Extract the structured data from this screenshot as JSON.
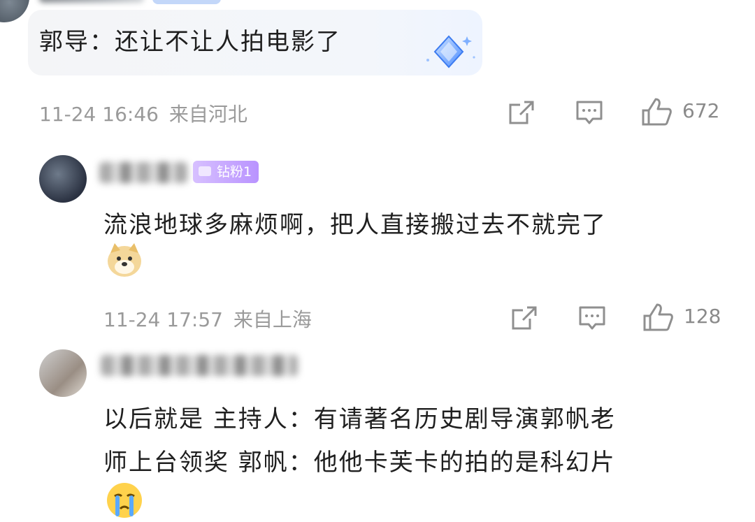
{
  "comments": [
    {
      "reply": "郭导：还让不让人拍电影了",
      "time": "11-24 16:46",
      "location": "来自河北",
      "likes": "672",
      "icons": [
        "share-icon",
        "comment-icon",
        "like-icon"
      ]
    },
    {
      "badge": "钻粉1",
      "text": "流浪地球多麻烦啊，把人直接搬过去不就完了",
      "emoji": "doge-emoji",
      "time": "11-24 17:57",
      "location": "来自上海",
      "likes": "128",
      "icons": [
        "share-icon",
        "comment-icon",
        "like-icon"
      ]
    },
    {
      "text_line1": "以后就是 主持人：有请著名历史剧导演郭帆老",
      "text_line2": "师上台领奖 郭帆：他他卡芙卡的拍的是科幻片",
      "emoji": "crying-emoji"
    }
  ],
  "colors": {
    "meta_text": "#9a9a9a",
    "badge_purple": "#b993ff",
    "reply_bubble": "#f4f5f7"
  }
}
